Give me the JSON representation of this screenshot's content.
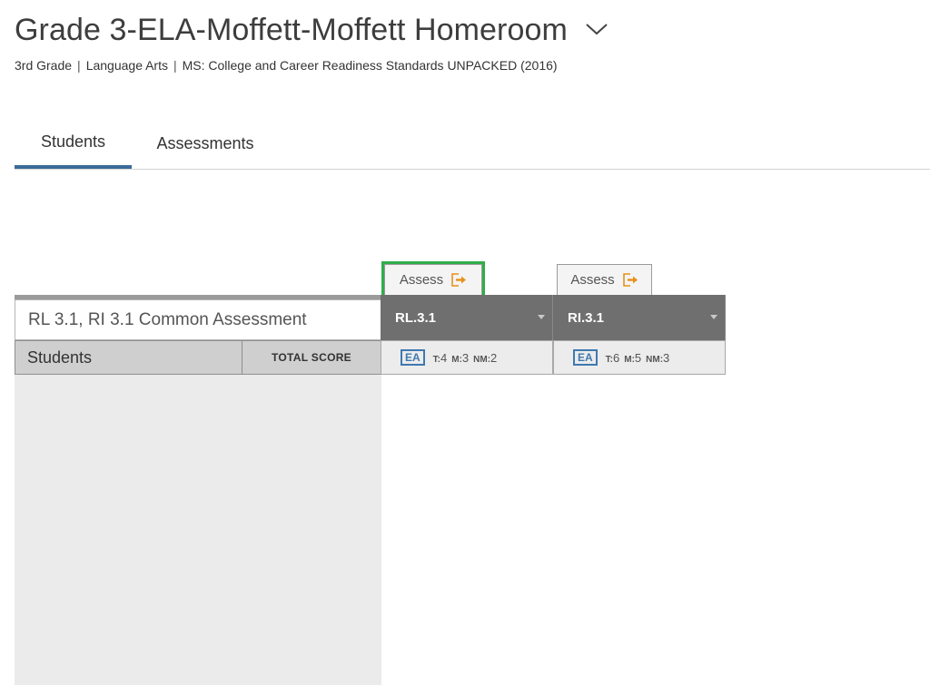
{
  "header": {
    "title": "Grade 3-ELA-Moffett-Moffett Homeroom",
    "subtitle": {
      "grade": "3rd Grade",
      "subject": "Language Arts",
      "standards": "MS: College and Career Readiness Standards UNPACKED (2016)",
      "separator": "|"
    }
  },
  "tabs": [
    {
      "label": "Students",
      "active": true
    },
    {
      "label": "Assessments",
      "active": false
    }
  ],
  "grid": {
    "assessment_name": "RL 3.1, RI 3.1 Common Assessment",
    "students_header": "Students",
    "total_score_header": "TOTAL SCORE",
    "assess_label": "Assess",
    "standards": [
      {
        "code": "RL.3.1",
        "badge": "EA",
        "stats": {
          "t_label": "T:",
          "t": "4",
          "m_label": "M:",
          "m": "3",
          "nm_label": "NM:",
          "nm": "2"
        },
        "highlighted": true
      },
      {
        "code": "RI.3.1",
        "badge": "EA",
        "stats": {
          "t_label": "T:",
          "t": "6",
          "m_label": "M:",
          "m": "5",
          "nm_label": "NM:",
          "nm": "3"
        },
        "highlighted": false
      }
    ]
  },
  "colors": {
    "tab_active": "#3a6b9a",
    "highlight": "#2fae4a",
    "assess_icon": "#e8901a",
    "ea_badge": "#3e79b0",
    "standard_header": "#6f6f6f"
  },
  "icons": {
    "title_dropdown": "chevron-down-icon",
    "assess": "export-arrow-icon",
    "standard_menu": "caret-down-icon"
  }
}
